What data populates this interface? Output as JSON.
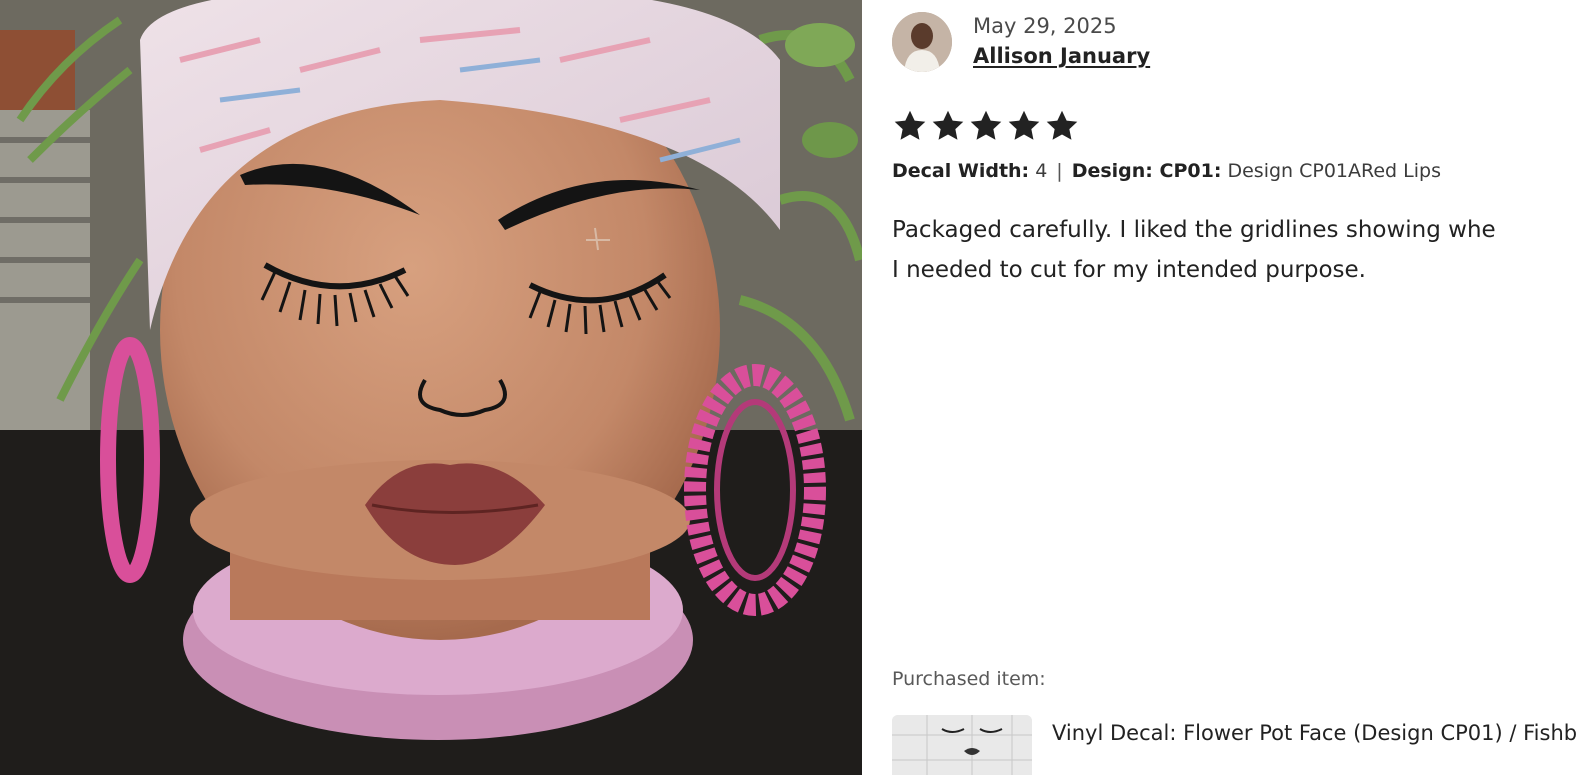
{
  "review": {
    "date": "May 29, 2025",
    "author": "Allison January",
    "rating": 5,
    "variations": [
      {
        "label": "Decal Width:",
        "value": "4"
      },
      {
        "label": "Design: CP01:",
        "value": "Design CP01ARed Lips"
      }
    ],
    "text_lines": [
      "Packaged carefully. I liked the gridlines showing whe",
      "I needed to cut for my intended purpose."
    ],
    "purchased_label": "Purchased item:",
    "item_title": "Vinyl Decal: Flower Pot Face (Design CP01) / Fishb"
  },
  "icons": {
    "star": "star-filled-icon"
  },
  "colors": {
    "star": "#222222",
    "pot": "#c98f6f",
    "saucer": "#d9a3c4",
    "lips": "#8b3e3c",
    "earring": "#d94f9a"
  }
}
